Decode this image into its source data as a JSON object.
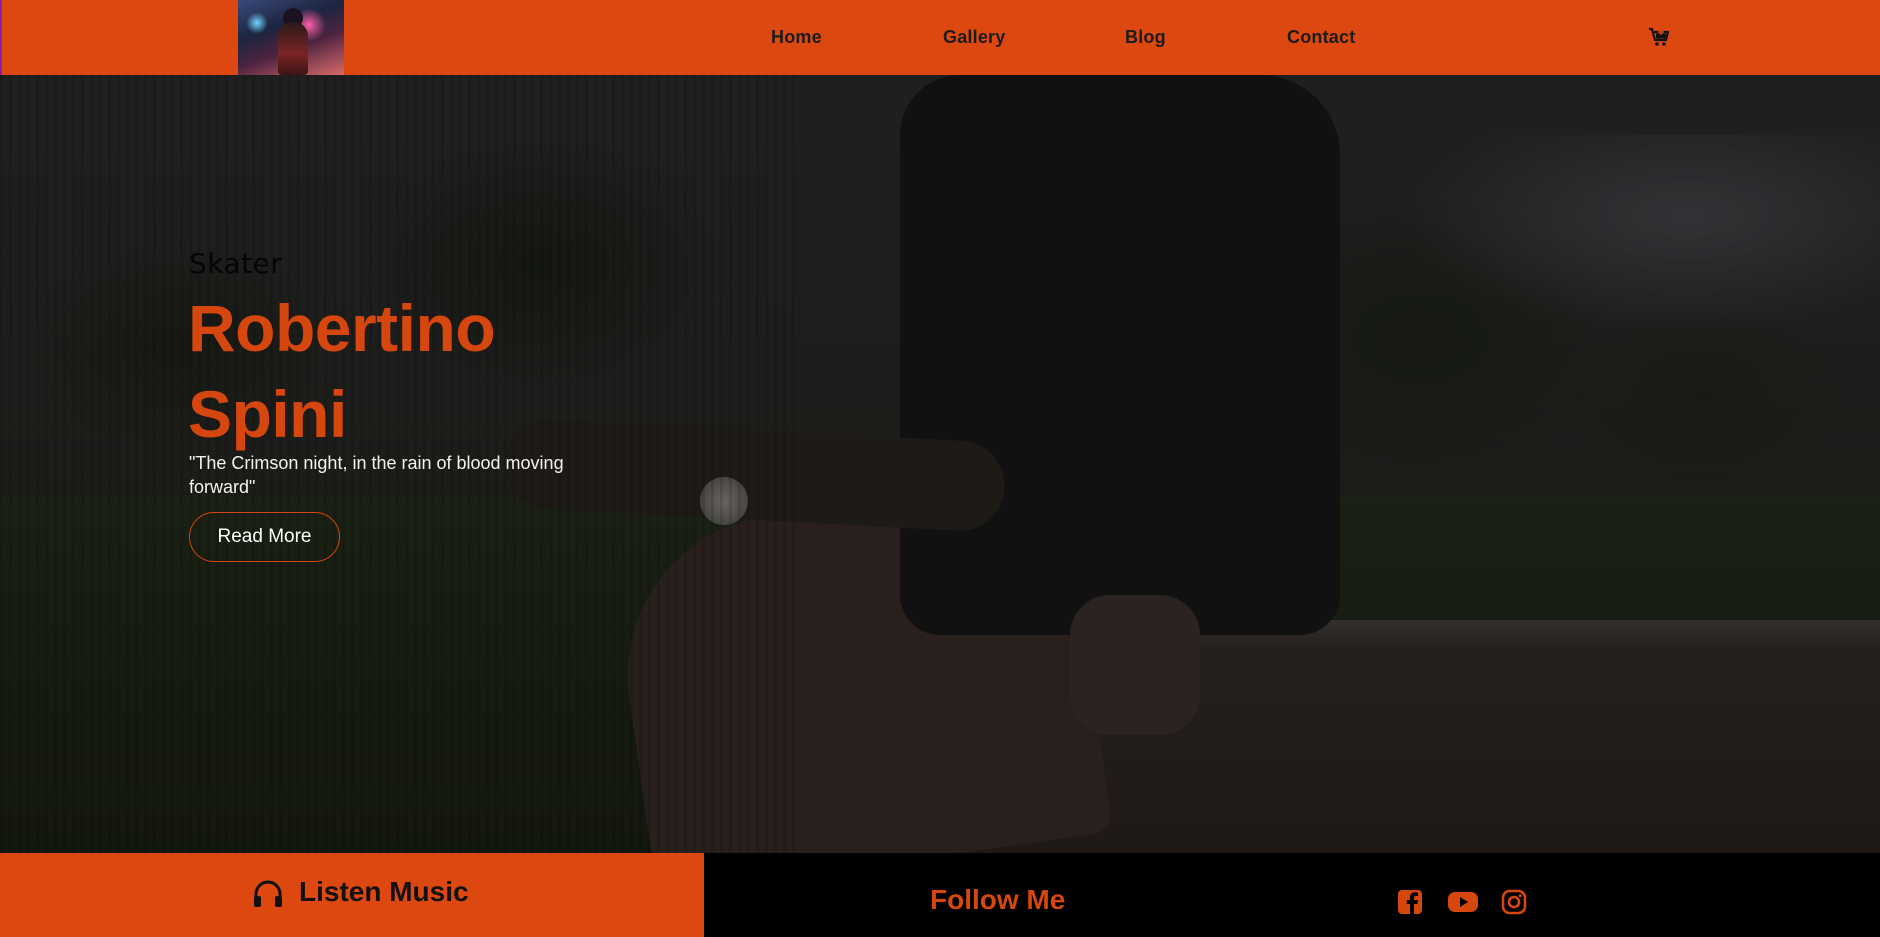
{
  "header": {
    "nav": [
      {
        "label": "Home"
      },
      {
        "label": "Gallery"
      },
      {
        "label": "Blog"
      },
      {
        "label": "Contact"
      }
    ],
    "cart_icon": "shopping-cart-icon",
    "logo": "profile-logo-image"
  },
  "hero": {
    "subtitle": "Skater",
    "name": "Robertino Spini",
    "quote": "\"The Crimson night, in the rain of blood moving forward\"",
    "button_label": "Read More",
    "background": "skater-sitting-on-bench-photo"
  },
  "footer": {
    "listen_label": "Listen Music",
    "listen_icon": "headphones-icon",
    "follow_label": "Follow Me",
    "social": [
      {
        "icon": "facebook-icon"
      },
      {
        "icon": "youtube-icon"
      },
      {
        "icon": "instagram-icon"
      }
    ]
  },
  "colors": {
    "accent": "#dc4810",
    "accent_text": "#d6460f",
    "footer_dark": "#000000"
  }
}
